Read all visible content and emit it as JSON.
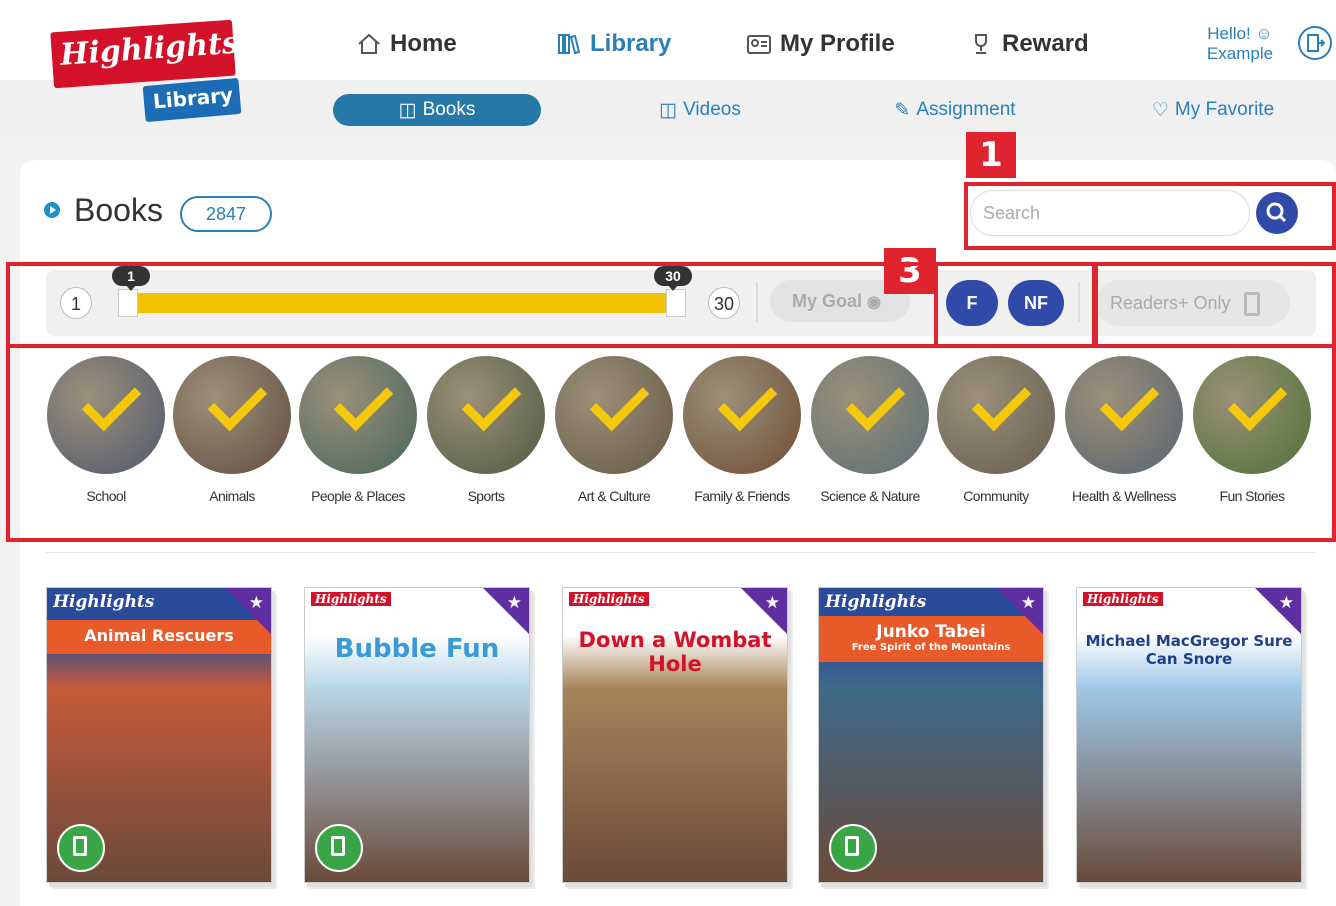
{
  "header": {
    "logo_text": "Highlights",
    "logo_sub": "Library",
    "nav": [
      {
        "label": "Home",
        "icon": "home-icon"
      },
      {
        "label": "Library",
        "icon": "library-icon",
        "active": true
      },
      {
        "label": "My Profile",
        "icon": "profile-icon"
      },
      {
        "label": "Reward",
        "icon": "trophy-icon"
      }
    ],
    "greeting": "Hello!",
    "username": "Example"
  },
  "subnav": [
    {
      "label": "Books",
      "icon": "books-icon",
      "active": true
    },
    {
      "label": "Videos",
      "icon": "videos-icon"
    },
    {
      "label": "Assignment",
      "icon": "assignment-icon"
    },
    {
      "label": "My Favorite",
      "icon": "heart-icon"
    }
  ],
  "page": {
    "title": "Books",
    "count": "2847",
    "search_placeholder": "Search"
  },
  "filters": {
    "level_min": "1",
    "level_max": "30",
    "range_low": "1",
    "range_high": "30",
    "my_goal": "My Goal",
    "fiction": "F",
    "nonfiction": "NF",
    "readers_only": "Readers+ Only"
  },
  "annotations": [
    "1",
    "3"
  ],
  "categories": [
    {
      "label": "School",
      "color": "#6e7a9a"
    },
    {
      "label": "Animals",
      "color": "#8a6a5a"
    },
    {
      "label": "People & Places",
      "color": "#5f8e80"
    },
    {
      "label": "Sports",
      "color": "#6a7e5a"
    },
    {
      "label": "Art & Culture",
      "color": "#8a7a5e"
    },
    {
      "label": "Family & Friends",
      "color": "#9a6a4a"
    },
    {
      "label": "Science & Nature",
      "color": "#7e9aa6"
    },
    {
      "label": "Community",
      "color": "#8e8070"
    },
    {
      "label": "Health & Wellness",
      "color": "#7a8a9e"
    },
    {
      "label": "Fun Stories",
      "color": "#6a9e4a"
    }
  ],
  "books": [
    {
      "title": "Animal Rescuers",
      "brand": "Highlights",
      "cover": "#c65a3a"
    },
    {
      "title": "Bubble Fun",
      "brand": "Highlights",
      "cover": "#b8d6e8"
    },
    {
      "title": "Down a Wombat Hole",
      "brand": "Highlights",
      "cover": "#a8845a"
    },
    {
      "title": "Junko Tabei",
      "subtitle": "Free Spirit of the Mountains",
      "brand": "Highlights",
      "cover": "#3e6a8a"
    },
    {
      "title": "Michael MacGregor Sure Can Snore",
      "brand": "Highlights",
      "cover": "#9ec8e8"
    }
  ]
}
